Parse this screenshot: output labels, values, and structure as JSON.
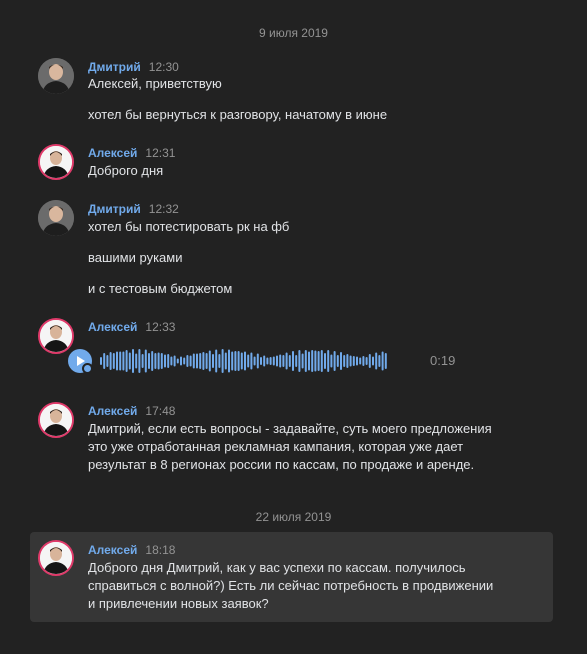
{
  "dates": [
    "9 июля 2019",
    "22 июля 2019"
  ],
  "messages": [
    {
      "author": "Дмитрий",
      "time": "12:30",
      "lines": [
        "Алексей, приветствую",
        "хотел бы вернуться к разговору, начатому в июне"
      ]
    },
    {
      "author": "Алексей",
      "time": "12:31",
      "lines": [
        "Доброго дня"
      ]
    },
    {
      "author": "Дмитрий",
      "time": "12:32",
      "lines": [
        "хотел бы потестировать рк на фб",
        "вашими руками",
        "и с тестовым бюджетом"
      ]
    },
    {
      "author": "Алексей",
      "time": "12:33",
      "voice": {
        "duration": "0:19",
        "icon": "play-icon"
      }
    },
    {
      "author": "Алексей",
      "time": "17:48",
      "lines": [
        "Дмитрий, если есть вопросы - задавайте, суть моего предложения",
        "это уже отработанная рекламная кампания, которая уже дает",
        "результат в 8 регионах россии по кассам, по продаже и аренде."
      ]
    },
    {
      "author": "Алексей",
      "time": "18:18",
      "lines": [
        "Доброго дня Дмитрий, как у вас успехи по кассам. получилось",
        "справиться с волной?) Есть ли сейчас потребность в продвижении",
        "и привлечении новых заявок?"
      ]
    }
  ],
  "colors": {
    "background": "#222222",
    "author": "#71aaeb",
    "meta": "#939393",
    "highlight": "#363636"
  }
}
